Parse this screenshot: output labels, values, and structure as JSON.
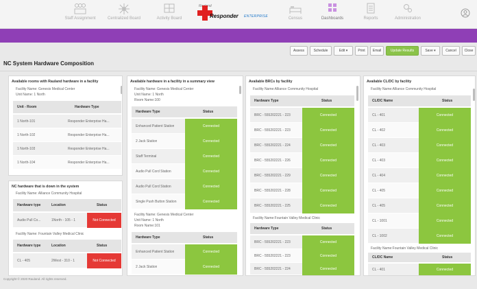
{
  "nav": {
    "items": [
      {
        "label": "Staff Assignment"
      },
      {
        "label": "Centralized Board"
      },
      {
        "label": "Activity Board"
      },
      {
        "label": "Census"
      },
      {
        "label": "Dashboards"
      },
      {
        "label": "Reports"
      },
      {
        "label": "Administration"
      }
    ],
    "logo": {
      "brand": "Rauland",
      "product": "Responder",
      "edition": "ENTERPRISE"
    },
    "active": "Dashboards"
  },
  "toolbar": {
    "buttons": [
      "Assess",
      "Schedule",
      "Edit",
      "Print",
      "Email",
      "Update Results",
      "Save",
      "Cancel",
      "Close"
    ]
  },
  "page_title": "NC System Hardware Composition",
  "colors": {
    "accent": "#8f3fb6",
    "connected": "#8cc63f",
    "not_connected": "#e53935"
  },
  "panels": {
    "rooms": {
      "title": "Available rooms with Rauland hardware in a facility",
      "facility": "Facility Name: Genesis Medical Center",
      "unit": "Unit Name: 1 North",
      "headers": [
        "Unit - Room",
        "Hardware Type"
      ],
      "rows": [
        [
          "1 North-101",
          "Responder Enterprise Ha..."
        ],
        [
          "1 North-102",
          "Responder Enterprise Ha..."
        ],
        [
          "1 North-103",
          "Responder Enterprise Ha..."
        ],
        [
          "1 North-104",
          "Responder Enterprise Ha..."
        ]
      ]
    },
    "down": {
      "title": "NC hardware that is down in the system",
      "groups": [
        {
          "facility": "Facility Name: Alliance Community Hospital",
          "headers": [
            "Hardware type",
            "Location",
            "Status"
          ],
          "rows": [
            [
              "Audio Pull Co...",
              "1North - 105 - 1",
              "Not Connected"
            ]
          ]
        },
        {
          "facility": "Facility Name: Fountain Valley Medical Clinic",
          "headers": [
            "Hardware type",
            "Location",
            "Status"
          ],
          "rows": [
            [
              "CL - 405",
              "2West - 310 - 1",
              "Not Connected"
            ]
          ]
        }
      ]
    },
    "summary": {
      "title": "Available hardware in a facility in a summary view",
      "groups": [
        {
          "facility": "Facility Name: Genesis Medical Center",
          "unit": "Unit Name: 1 North",
          "room": "Room Name:100",
          "headers": [
            "Hardware Type",
            "Status"
          ],
          "rows": [
            [
              "Enhanced Patient Station",
              "Connected"
            ],
            [
              "2 Jack Station",
              "Connected"
            ],
            [
              "Staff Terminal",
              "Connected"
            ],
            [
              "Audio Pull Cord Station",
              "Connected"
            ],
            [
              "Audio Pull Cord Station",
              "Connected"
            ],
            [
              "Single Push Button Station",
              "Connected"
            ]
          ]
        },
        {
          "facility": "Facility Name: Genesis Medical Center",
          "unit": "Unit Name: 1 North",
          "room": "Room Name:101",
          "headers": [
            "Hardware Type",
            "Status"
          ],
          "rows": [
            [
              "Enhanced Patient Station",
              "Connected"
            ],
            [
              "2 Jack Station",
              "Connected"
            ]
          ]
        }
      ]
    },
    "brcs": {
      "title": "Available BRCs by facility",
      "groups": [
        {
          "facility": "Facility Name:Alliance Community Hospital",
          "headers": [
            "Hardware Type",
            "Status"
          ],
          "rows": [
            [
              "BRC - 555202221 - 223",
              "Connected"
            ],
            [
              "BRC - 555202221 - 223",
              "Connected"
            ],
            [
              "BRC - 555202221 - 224",
              "Connected"
            ],
            [
              "BRC - 555202221 - 226",
              "Connected"
            ],
            [
              "BRC - 555202221 - 229",
              "Connected"
            ],
            [
              "BRC - 555202221 - 228",
              "Connected"
            ],
            [
              "BRC - 555202221 - 225",
              "Connected"
            ]
          ]
        },
        {
          "facility": "Facility Name:Fountain Valley Medical Clinic",
          "headers": [
            "Hardware Type",
            "Status"
          ],
          "rows": [
            [
              "BRC - 555202221 - 223",
              "Connected"
            ],
            [
              "BRC - 555202221 - 223",
              "Connected"
            ],
            [
              "BRC - 555202221 - 224",
              "Connected"
            ]
          ]
        }
      ]
    },
    "clocs": {
      "title": "Available CL/DC by facility",
      "groups": [
        {
          "facility": "Facility Name:Alliance Community Hospital",
          "headers": [
            "CL/DC Name",
            "Status"
          ],
          "rows": [
            [
              "CL - 401",
              "Connected"
            ],
            [
              "CL - 402",
              "Connected"
            ],
            [
              "CL - 403",
              "Connected"
            ],
            [
              "CL - 403",
              "Connected"
            ],
            [
              "CL - 404",
              "Connected"
            ],
            [
              "CL - 405",
              "Connected"
            ],
            [
              "CL - 405",
              "Connected"
            ],
            [
              "CL - 1001",
              "Connected"
            ],
            [
              "CL - 1002",
              "Connected"
            ]
          ]
        },
        {
          "facility": "Facility Name:Fountain Valley Medical Clinic",
          "headers": [
            "CL/DC Name",
            "Status"
          ],
          "rows": [
            [
              "CL - 401",
              "Connected"
            ]
          ]
        }
      ]
    }
  },
  "footer": "Copyright © 2020 Rauland. All rights reserved."
}
